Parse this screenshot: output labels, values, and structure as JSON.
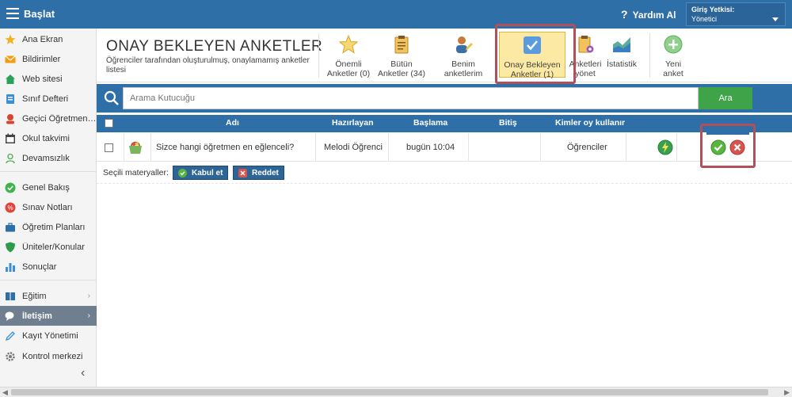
{
  "topbar": {
    "brand": "Başlat",
    "help": "Yardım Al",
    "auth_label": "Giriş Yetkisi:",
    "auth_value": "Yönetici"
  },
  "sidebar": {
    "items": [
      {
        "label": "Ana Ekran",
        "icon": "star-icon",
        "color": "#f0b323"
      },
      {
        "label": "Bildirimler",
        "icon": "envelope-icon",
        "color": "#f39c12"
      },
      {
        "label": "Web sitesi",
        "icon": "house-icon",
        "color": "#27a35a"
      },
      {
        "label": "Sınıf Defteri",
        "icon": "notebook-icon",
        "color": "#3b8fd9"
      },
      {
        "label": "Geçici Öğretmenler",
        "icon": "person-icon",
        "color": "#d9442f"
      },
      {
        "label": "Okul takvimi",
        "icon": "calendar-icon",
        "color": "#444444"
      },
      {
        "label": "Devamsızlık",
        "icon": "user-outline-icon",
        "color": "#4caf50"
      },
      {
        "label": "Genel Bakış",
        "icon": "check-circle-icon",
        "color": "#3fb34f"
      },
      {
        "label": "Sınav Notları",
        "icon": "chart-circle-icon",
        "color": "#e0443a"
      },
      {
        "label": "Öğretim Planları",
        "icon": "briefcase-icon",
        "color": "#2f6fa8"
      },
      {
        "label": "Üniteler/Konular",
        "icon": "shield-icon",
        "color": "#2e9a4a"
      },
      {
        "label": "Sonuçlar",
        "icon": "bar-chart-icon",
        "color": "#3b8fd9"
      },
      {
        "label": "Eğitim",
        "icon": "book-icon",
        "color": "#2f6fa8"
      },
      {
        "label": "İletişim",
        "icon": "chat-icon",
        "color": "#ffffff"
      },
      {
        "label": "Kayıt Yönetimi",
        "icon": "pencil-icon",
        "color": "#3b8fd9"
      },
      {
        "label": "Kontrol merkezi",
        "icon": "gear-icon",
        "color": "#7a7a7a"
      }
    ]
  },
  "header": {
    "title": "Onay Bekleyen Anketler",
    "subtitle": "Öğrenciler tarafından oluşturulmuş, onaylamamış anketler listesi"
  },
  "tools": [
    {
      "line1": "Önemli",
      "line2": "Anketler (0)"
    },
    {
      "line1": "Bütün",
      "line2": "Anketler (34)"
    },
    {
      "line1": "Benim anketlerim",
      "line2": ""
    },
    {
      "line1": "Onay Bekleyen",
      "line2": "Anketler (1)"
    },
    {
      "line1": "Anketleri",
      "line2": "yönet"
    },
    {
      "line1": "İstatistik",
      "line2": ""
    },
    {
      "line1": "Yeni",
      "line2": "anket"
    }
  ],
  "search": {
    "placeholder": "Arama Kutucuğu",
    "button": "Ara"
  },
  "table": {
    "headers": [
      "Adı",
      "Hazırlayan",
      "Başlama",
      "Bitiş",
      "Kimler oy kullanır"
    ],
    "rows": [
      {
        "name": "Sizce hangi öğretmen en eğlenceli?",
        "author": "Melodi Öğrenci",
        "start": "bugün 10:04",
        "end": "",
        "voters": "Öğrenciler"
      }
    ]
  },
  "actions": {
    "label": "Seçili materyaller:",
    "accept": "Kabul et",
    "reject": "Reddet"
  },
  "colors": {
    "primary": "#2f6fa8",
    "highlight": "#b0505a",
    "search_go": "#3fa349"
  }
}
